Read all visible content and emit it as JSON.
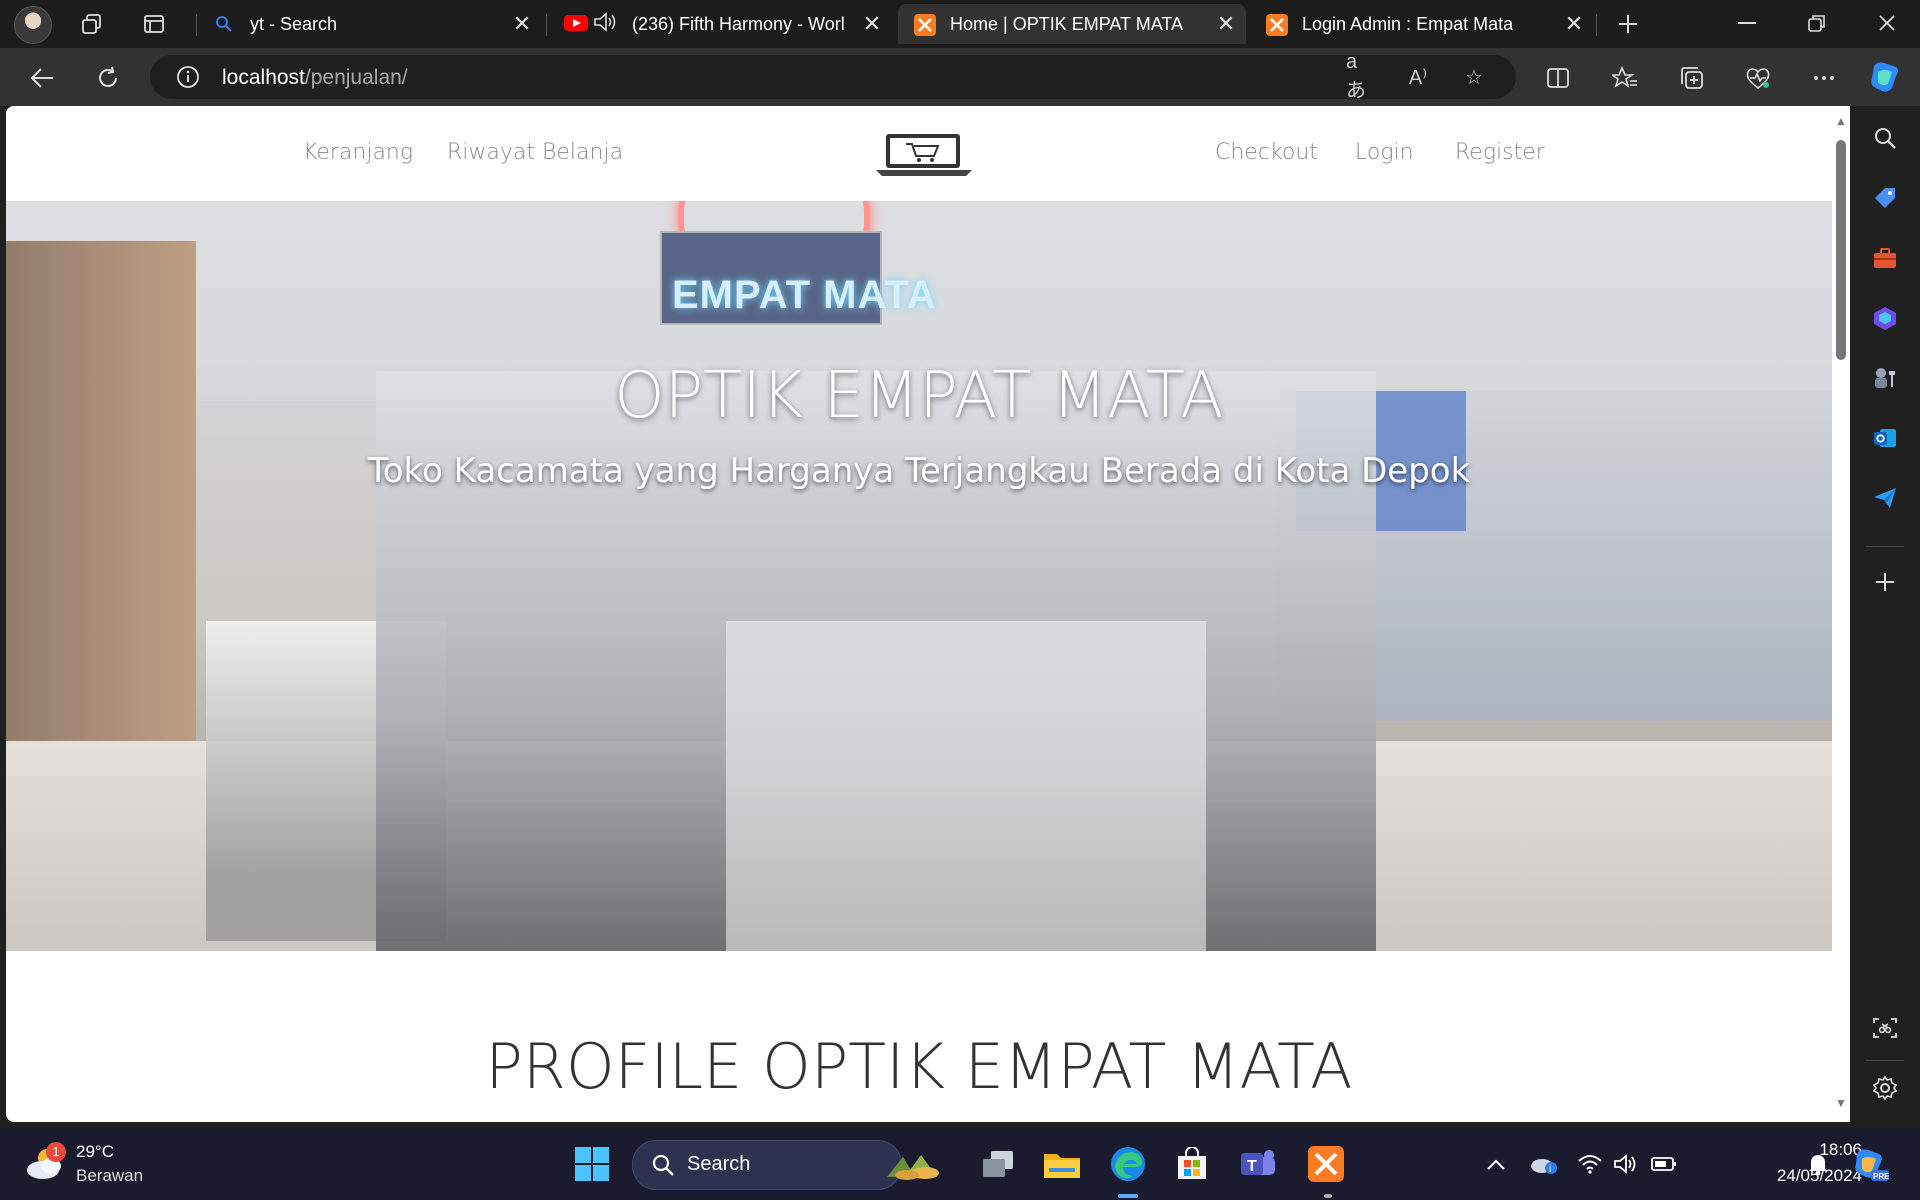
{
  "browser": {
    "tabs": [
      {
        "title": "yt - Search",
        "favicon": "search-icon"
      },
      {
        "title": "(236) Fifth Harmony - Worl",
        "favicon": "youtube-icon",
        "audio": "speaker-icon"
      },
      {
        "title": "Home | OPTIK EMPAT MATA",
        "favicon": "xampp-icon",
        "active": true
      },
      {
        "title": "Login Admin : Empat Mata",
        "favicon": "xampp-icon"
      }
    ],
    "url": {
      "host": "localhost",
      "path": "/penjualan/"
    },
    "accent": "#323232"
  },
  "site": {
    "nav_left": [
      "Keranjang",
      "Riwayat Belanja"
    ],
    "nav_right": [
      "Checkout",
      "Login",
      "Register"
    ],
    "hero": {
      "title": "OPTIK EMPAT MATA",
      "subtitle": "Toko Kacamata yang Harganya Terjangkau Berada di Kota Depok",
      "sign_text": "EMPAT MATA"
    },
    "profile_heading": "PROFILE OPTIK EMPAT MATA"
  },
  "taskbar": {
    "weather": {
      "temp": "29°C",
      "desc": "Berawan",
      "badge": "1"
    },
    "search_label": "Search",
    "time": "18:06",
    "date": "24/05/2024"
  }
}
